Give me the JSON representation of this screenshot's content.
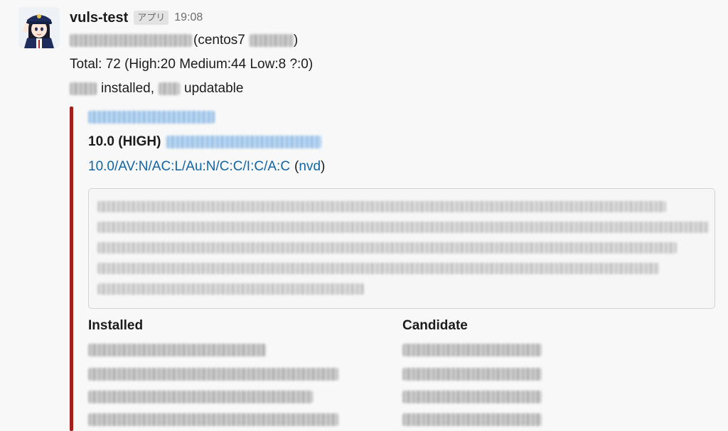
{
  "message": {
    "sender": "vuls-test",
    "badge": "アプリ",
    "time": "19:08",
    "host_suffix": "(centos7",
    "host_close": ")",
    "total": "Total: 72 (High:20 Medium:44 Low:8 ?:0)",
    "installed_label": "installed,",
    "updatable_label": "updatable"
  },
  "attachment": {
    "accent_color": "#a5201c",
    "score": "10.0 (HIGH)",
    "vector": "10.0/AV:N/AC:L/Au:N/C:C/I:C/A:C",
    "source_open": "(",
    "source": "nvd",
    "source_close": ")",
    "installed_header": "Installed",
    "candidate_header": "Candidate"
  }
}
